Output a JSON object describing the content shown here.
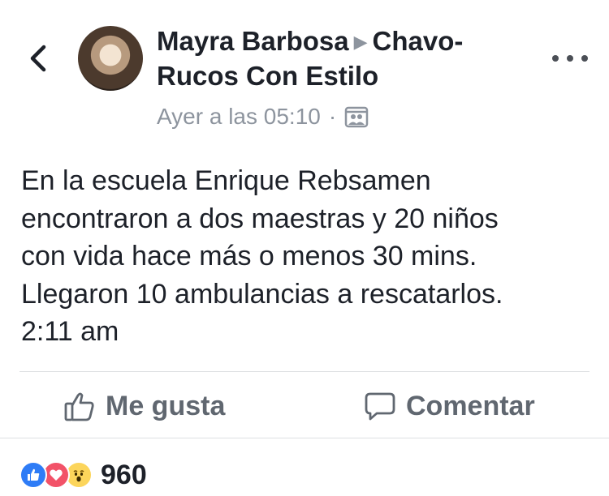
{
  "post": {
    "author": "Mayra Barbosa",
    "group_line1": "Chavo-",
    "group_line2": "Rucos Con Estilo",
    "timestamp": "Ayer a las 05:10",
    "separator": "·",
    "privacy_icon": "group-audience-icon",
    "text_lines": [
      "En la escuela Enrique Rebsamen",
      "encontraron a dos maestras y 20 niños",
      "con vida hace más o menos 30 mins.",
      "Llegaron 10 ambulancias a rescatarlos.",
      "2:11 am"
    ]
  },
  "nav": {
    "back_icon": "chevron-left-icon",
    "more_icon": "more-dots-icon"
  },
  "actions": {
    "like_label": "Me gusta",
    "comment_label": "Comentar"
  },
  "reactions": {
    "types": [
      "like",
      "love",
      "wow"
    ],
    "count": "960"
  },
  "colors": {
    "like_blue": "#2e7cf6",
    "love_red": "#f25268",
    "wow_yellow": "#fcd55b",
    "meta_gray": "#8d949e"
  }
}
